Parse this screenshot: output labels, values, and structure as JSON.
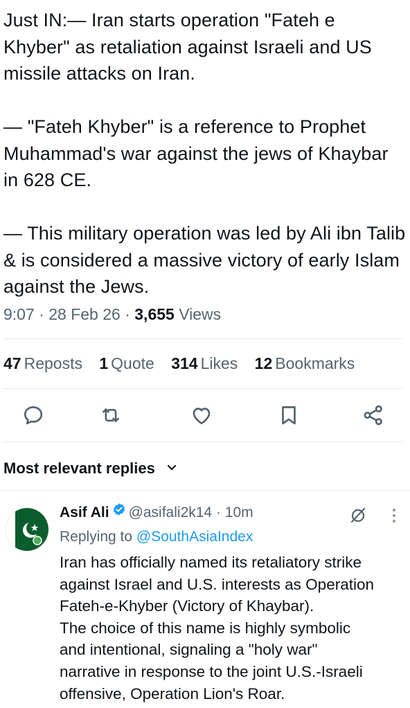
{
  "tweet": {
    "paragraphs": [
      "Just IN:— Iran starts operation \"Fateh e Khyber\" as retaliation against Israeli and US missile attacks on Iran.",
      "— \"Fateh Khyber\" is a reference to Prophet Muhammad's war against the jews of Khaybar in 628 CE.",
      "— This military operation was led by Ali ibn Talib & is considered a massive victory of early Islam against the Jews."
    ],
    "time": "9:07",
    "date": "28 Feb 26",
    "views_count": "3,655",
    "views_label": "Views",
    "separator": "·"
  },
  "stats": {
    "reposts_count": "47",
    "reposts_label": "Reposts",
    "quotes_count": "1",
    "quotes_label": "Quote",
    "likes_count": "314",
    "likes_label": "Likes",
    "bookmarks_count": "12",
    "bookmarks_label": "Bookmarks"
  },
  "actions": {
    "reply_icon": "reply-icon",
    "repost_icon": "repost-icon",
    "like_icon": "heart-icon",
    "bookmark_icon": "bookmark-icon",
    "share_icon": "share-icon"
  },
  "replies": {
    "header": "Most relevant replies"
  },
  "reply": {
    "name": "Asif Ali",
    "handle": "@asifali2k14",
    "separator": "·",
    "time": "10m",
    "replying_prefix": "Replying to",
    "replying_handle": "@SouthAsiaIndex",
    "lines": [
      "Iran has officially named its retaliatory strike",
      "against Israel and U.S. interests as Operation",
      "Fateh-e-Khyber (Victory of Khaybar).",
      "The choice of this name is highly symbolic",
      "and intentional, signaling a \"holy war\"",
      "narrative in response to the joint U.S.-Israeli",
      "offensive, Operation Lion's Roar."
    ]
  },
  "colors": {
    "text": "#0f1419",
    "secondary": "#536471",
    "accent": "#1d9bf0",
    "avatar_green": "#0b5d2e"
  }
}
